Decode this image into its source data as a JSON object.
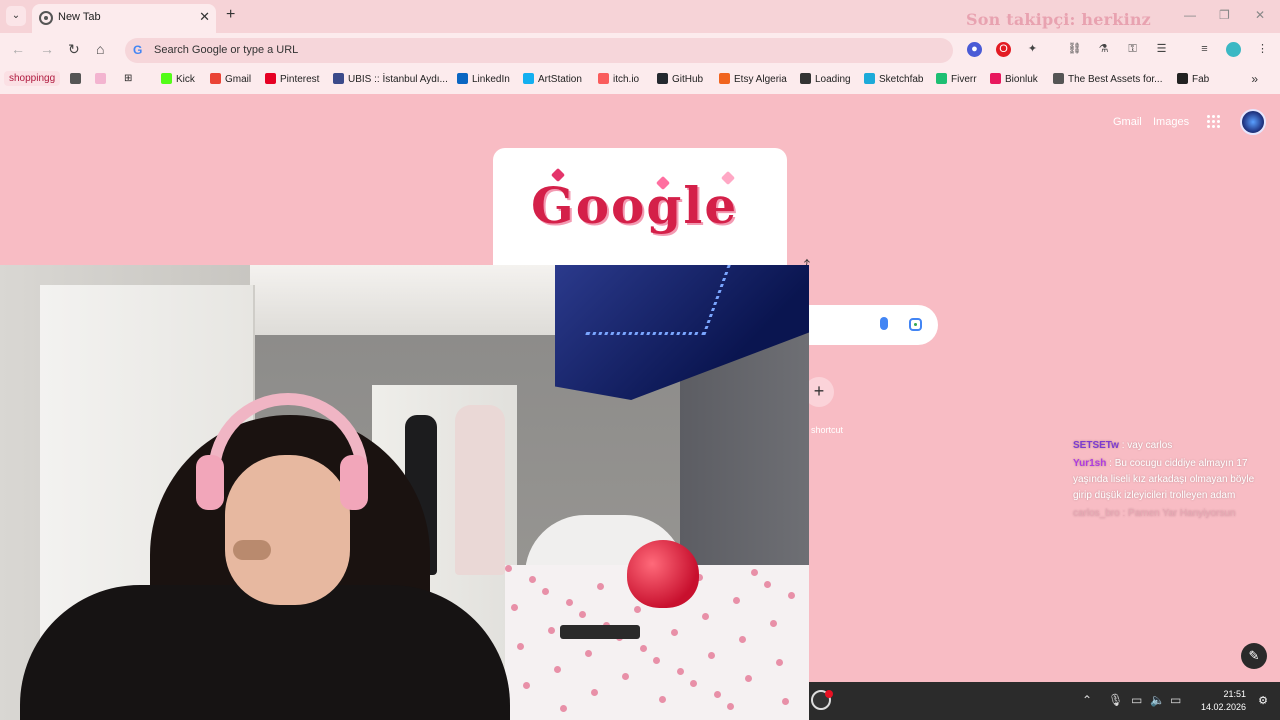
{
  "browser": {
    "tab": {
      "title": "New Tab"
    },
    "overlay_follower": "Son takipçi: herkinz",
    "omnibox_placeholder": "Search Google or type a URL",
    "bookmarks": [
      {
        "label": "Kick",
        "color": "#53fc18"
      },
      {
        "label": "Gmail",
        "color": "#ea4335"
      },
      {
        "label": "Pinterest",
        "color": "#e60023"
      },
      {
        "label": "UBIS :: İstanbul Aydı...",
        "color": "#3b4a8a"
      },
      {
        "label": "LinkedIn",
        "color": "#0a66c2"
      },
      {
        "label": "ArtStation",
        "color": "#13aff0"
      },
      {
        "label": "itch.io",
        "color": "#fa5c5c"
      },
      {
        "label": "GitHub",
        "color": "#24292f"
      },
      {
        "label": "Etsy Algeria",
        "color": "#f1641e"
      },
      {
        "label": "Loading",
        "color": "#333333"
      },
      {
        "label": "Sketchfab",
        "color": "#1caad9"
      },
      {
        "label": "Fiverr",
        "color": "#1dbf73"
      },
      {
        "label": "Bionluk",
        "color": "#e8175d"
      },
      {
        "label": "The Best Assets for...",
        "color": "#555555"
      },
      {
        "label": "Fab",
        "color": "#222222"
      }
    ],
    "bookmark_folder": "shoppingg"
  },
  "google": {
    "links": {
      "gmail": "Gmail",
      "images": "Images"
    },
    "doodle_text": "Google",
    "shortcut_label": "shortcut"
  },
  "chat": {
    "messages": [
      {
        "user": "SETSETw",
        "text": ": vay carlos"
      },
      {
        "user": "Yur1sh",
        "text": ": Bu cocugu ciddiye almayın 17 yaşında liseli kız arkadaşı olmayan böyle girip düşük izleyicileri trolleyen adam"
      },
      {
        "user": "carlos_bro",
        "text": ": Pamen Yar Hanyiyorsun"
      }
    ]
  },
  "taskbar": {
    "time": "21:51",
    "date": "14.02.2026"
  }
}
